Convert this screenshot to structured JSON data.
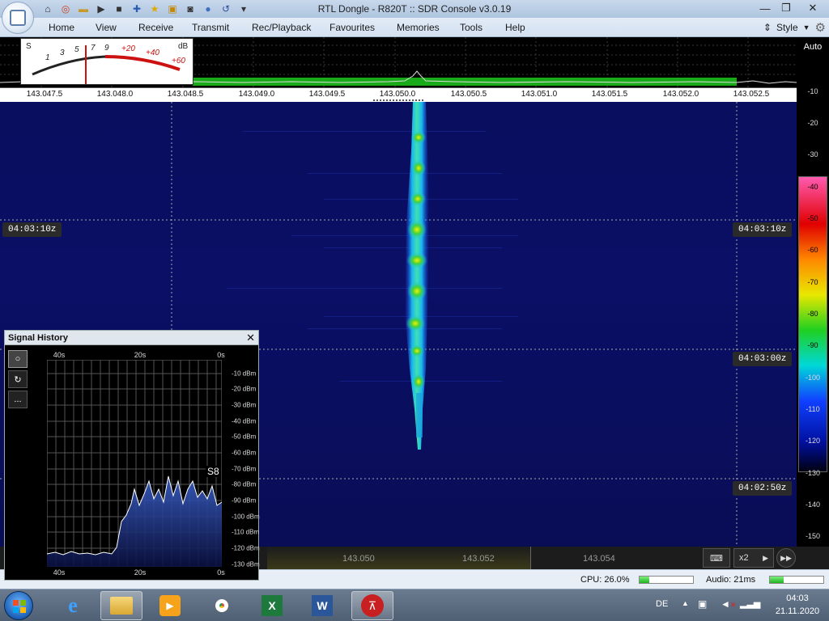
{
  "window": {
    "title": "RTL Dongle - R820T :: SDR Console v3.0.19"
  },
  "menu": {
    "items": [
      "Home",
      "View",
      "Receive",
      "Transmit",
      "Rec/Playback",
      "Favourites",
      "Memories",
      "Tools",
      "Help"
    ],
    "style_label": "Style"
  },
  "meter": {
    "s_label": "S",
    "db_label": "dB",
    "s_ticks": [
      "1",
      "3",
      "5",
      "7",
      "9"
    ],
    "db_ticks": [
      "+20",
      "+40",
      "+60"
    ]
  },
  "frequency_axis": [
    "143.047.5",
    "143.048.0",
    "143.048.5",
    "143.049.0",
    "143.049.5",
    "143.050.0",
    "143.050.5",
    "143.051.0",
    "143.051.5",
    "143.052.0",
    "143.052.5"
  ],
  "waterfall": {
    "timestamps": [
      "04:03:10z",
      "04:03:00z",
      "04:02:50z"
    ]
  },
  "db_scale": {
    "auto_label": "Auto",
    "labels": [
      "-10",
      "-20",
      "-30",
      "-40",
      "-50",
      "-60",
      "-70",
      "-80",
      "-90",
      "-100",
      "-110",
      "-120",
      "-130",
      "-140",
      "-150"
    ]
  },
  "bottom_bar": {
    "freq_labels": [
      "143.050",
      "143.052",
      "143.054"
    ],
    "zoom_label": "x2"
  },
  "status": {
    "cpu_text": "CPU: 26.0%",
    "cpu_level": 0.18,
    "audio_text": "Audio: 21ms",
    "audio_level": 0.25
  },
  "signal_history": {
    "title": "Signal History",
    "time_labels": [
      "40s",
      "20s",
      "0s"
    ],
    "db_labels": [
      "-10 dBm",
      "-20 dBm",
      "-30 dBm",
      "-40 dBm",
      "-50 dBm",
      "-60 dBm",
      "-70 dBm",
      "-80 dBm",
      "-90 dBm",
      "-100 dBm",
      "-110 dBm",
      "-120 dBm",
      "-130 dBm"
    ],
    "s_reading": "S8",
    "more_label": "..."
  },
  "taskbar": {
    "language": "DE",
    "time": "04:03",
    "date": "21.11.2020"
  },
  "colors": {
    "titlebar": "#aec4de",
    "waterfall_background": "#0b0f66",
    "signal_core": "#e8e800",
    "signal_body": "#18c8e8",
    "spectrum_noise": "#1cc81c",
    "meter_red": "#cc1111"
  }
}
